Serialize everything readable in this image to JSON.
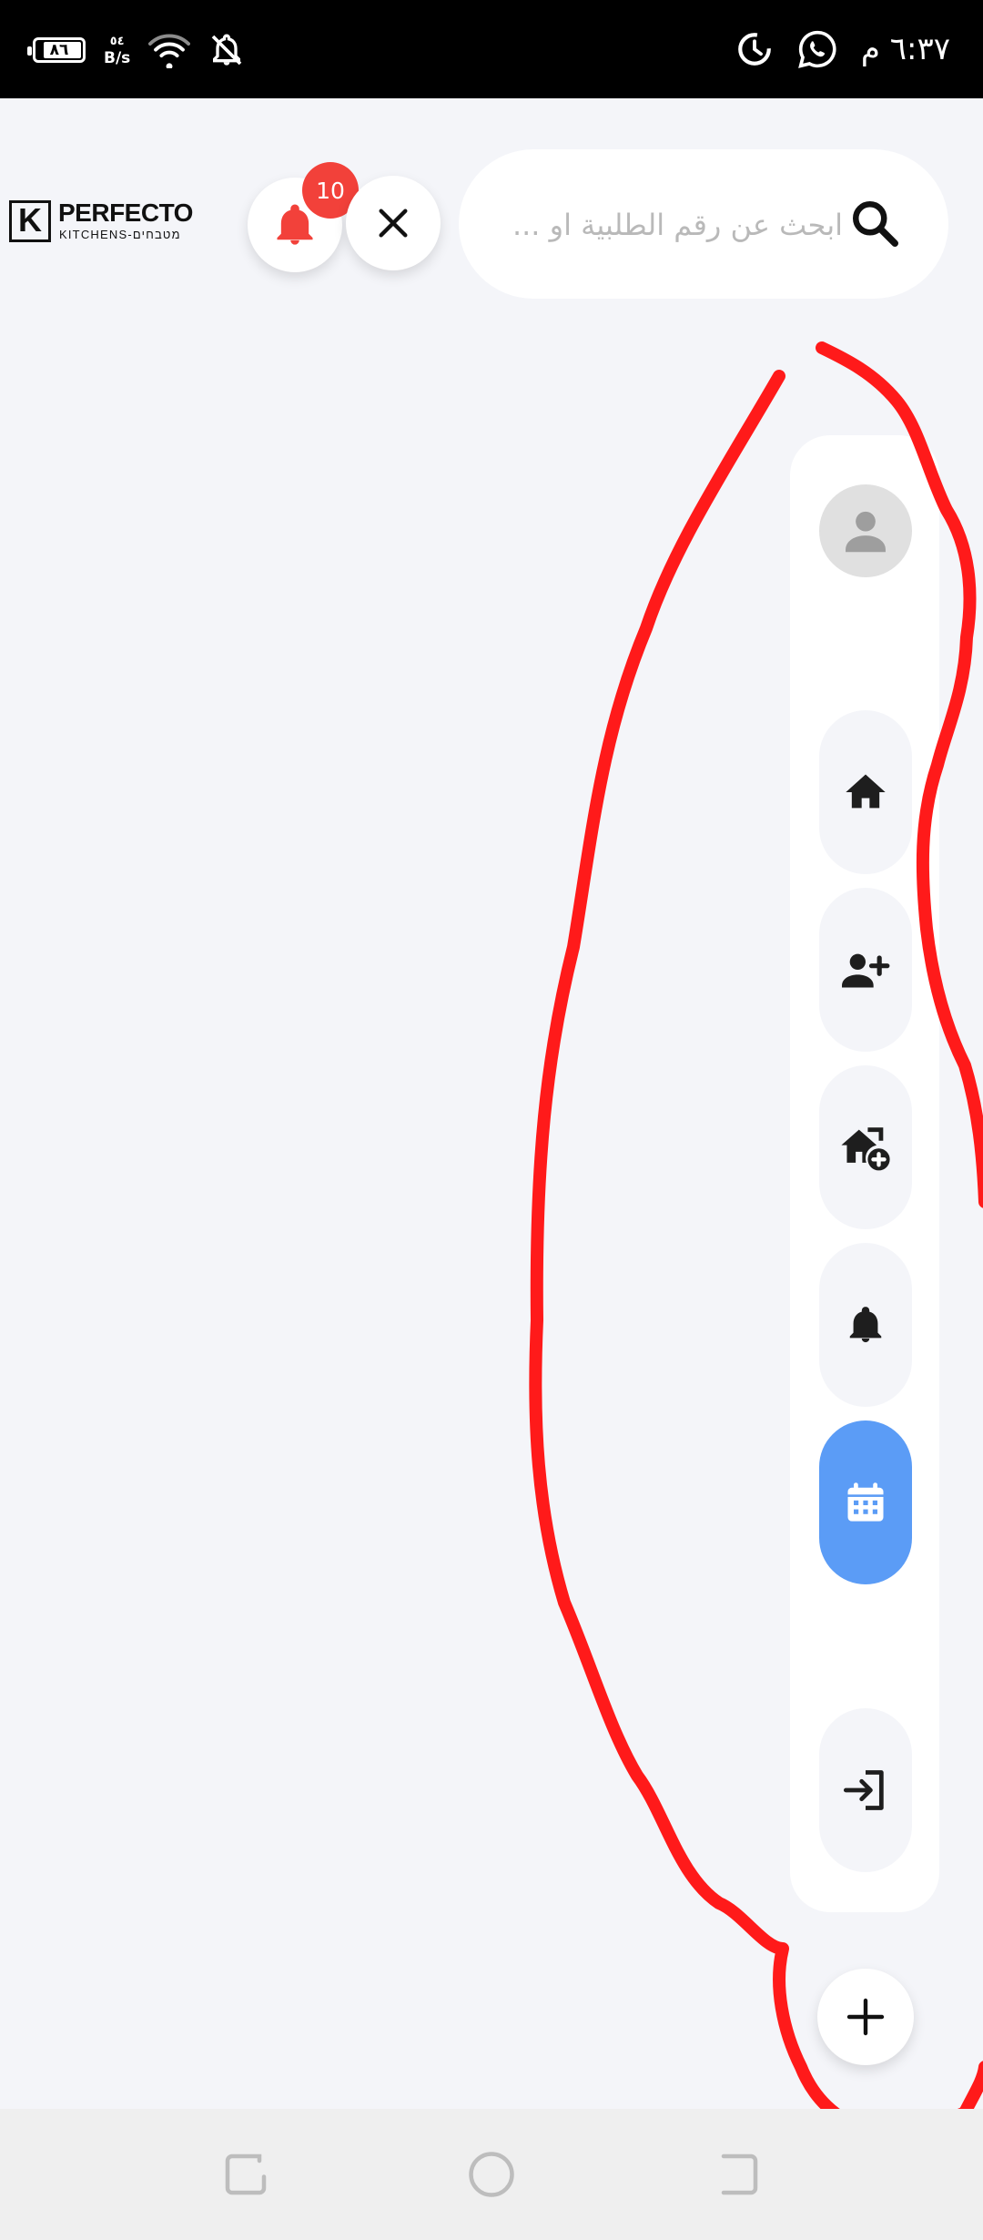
{
  "status_bar": {
    "battery_level": "٨٦",
    "battery_fraction": 0.86,
    "net_speed_value": "٥٤",
    "net_speed_unit": "B/s",
    "time": "٦:٣٧ م",
    "icons": [
      "battery-icon",
      "wifi-icon",
      "notifications-off-icon",
      "whatsapp-icon",
      "clock-app-icon"
    ]
  },
  "header": {
    "logo_title": "PERFECTO",
    "logo_subtitle": "KITCHENS-מטבחים",
    "logo_mark": "K",
    "notification_count": "10",
    "search_placeholder": "ابحث عن رقم الطلبية او ..."
  },
  "side_nav": {
    "items": [
      {
        "name": "home",
        "icon": "home-icon",
        "active": false
      },
      {
        "name": "add-user",
        "icon": "person-add-icon",
        "active": false
      },
      {
        "name": "add-home",
        "icon": "add-home-icon",
        "active": false
      },
      {
        "name": "notifications",
        "icon": "bell-icon",
        "active": false
      },
      {
        "name": "calendar",
        "icon": "calendar-icon",
        "active": true
      },
      {
        "name": "logout",
        "icon": "login-icon",
        "active": false
      }
    ]
  },
  "colors": {
    "background": "#f4f5f9",
    "accent": "#5b9cf6",
    "badge": "#f2413a",
    "annotation": "#ff1a1a"
  }
}
